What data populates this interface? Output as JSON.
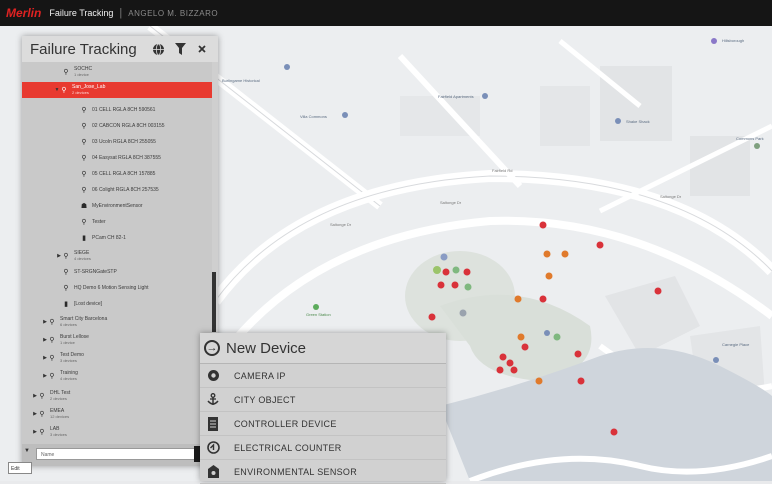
{
  "topbar": {
    "brand": "Merlin",
    "app_title": "Failure Tracking",
    "separator": "|",
    "breadcrumb": "ANGELO M. BIZZARO"
  },
  "map": {
    "streets": [
      "Fairfield Rd",
      "Saltonge Dr",
      "Saltonge Dr",
      "Saltonge Dr"
    ],
    "places": [
      "Burlingame Historical",
      "Fairfield Apartments",
      "Villa Commons",
      "Shake Shack",
      "Hillsborough",
      "Green Station",
      "Carnegie Place",
      "Commons Park"
    ]
  },
  "panel": {
    "title": "Failure Tracking",
    "items": [
      {
        "label": "SOCHC",
        "sub": "1 device",
        "icon": "pin"
      },
      {
        "label": "San_Jose_Lab",
        "sub": "2 devices",
        "icon": "pin",
        "selected": true
      },
      {
        "label": "01 CELL RGLA 8CH 590561",
        "icon": "pin"
      },
      {
        "label": "02 CABCON RGLA 8CH 003155",
        "icon": "pin"
      },
      {
        "label": "03 Ucoln RGLA 8CH 255055",
        "icon": "pin"
      },
      {
        "label": "04 Easysat RGLA 8CH 387555",
        "icon": "pin"
      },
      {
        "label": "05 CELL RGLA 8CH 157885",
        "icon": "pin"
      },
      {
        "label": "06 Colight RGLA 8CH 257535",
        "icon": "pin"
      },
      {
        "label": "MyEnvironmentSensor",
        "icon": "sensor"
      },
      {
        "label": "Tester",
        "icon": "pin"
      },
      {
        "label": "PCam CH 82-1",
        "icon": "box"
      },
      {
        "label": "SIEGE",
        "sub": "4 devices",
        "icon": "pin"
      },
      {
        "label": "ST-SRGNGateSTP",
        "icon": "pin"
      },
      {
        "label": "HQ Demo 6 Motion Sensing Light",
        "icon": "pin"
      },
      {
        "label": "[Lost device]",
        "icon": "box"
      },
      {
        "label": "Smart City Barcelona",
        "sub": "6 devices",
        "icon": "pin"
      },
      {
        "label": "Burst Lellose",
        "sub": "1 device",
        "icon": "pin"
      },
      {
        "label": "Test Demo",
        "sub": "3 devices",
        "icon": "pin"
      },
      {
        "label": "Training",
        "sub": "4 devices",
        "icon": "pin"
      },
      {
        "label": "DHL Test",
        "sub": "2 devices",
        "icon": "pin"
      },
      {
        "label": "EMEA",
        "sub": "12 devices",
        "icon": "pin"
      },
      {
        "label": "LAB",
        "sub": "3 devices",
        "icon": "pin"
      }
    ],
    "search_placeholder": "Name",
    "footer_left": "▼",
    "mini_tab": "Edit"
  },
  "new_device": {
    "title": "New Device",
    "items": [
      {
        "label": "CAMERA IP",
        "icon": "camera-icon"
      },
      {
        "label": "CITY OBJECT",
        "icon": "anchor-icon"
      },
      {
        "label": "CONTROLLER DEVICE",
        "icon": "controller-icon"
      },
      {
        "label": "ELECTRICAL COUNTER",
        "icon": "meter-icon"
      },
      {
        "label": "ENVIRONMENTAL SENSOR",
        "icon": "sensor-icon"
      }
    ]
  },
  "colors": {
    "accent": "#e83a30",
    "topbar": "#151515",
    "panel": "#c9c9c9"
  }
}
